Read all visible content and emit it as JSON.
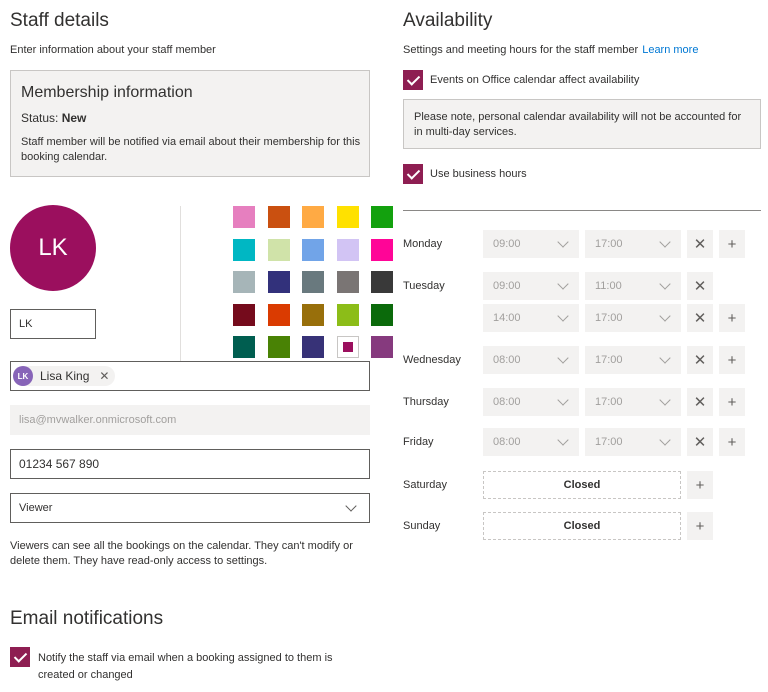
{
  "staff": {
    "title": "Staff details",
    "subtitle": "Enter information about your staff member",
    "membership": {
      "title": "Membership information",
      "status_label": "Status:",
      "status_value": "New",
      "note": "Staff member will be notified via email about their membership for this booking calendar."
    },
    "avatar_initials": "LK",
    "initials_value": "LK",
    "person": {
      "initials": "LK",
      "name": "Lisa King",
      "remove_glyph": "✕"
    },
    "email_value": "lisa@mvwalker.onmicrosoft.com",
    "phone_value": "01234 567 890",
    "role_value": "Viewer",
    "role_description": "Viewers can see all the bookings on the calendar. They can't modify or delete them. They have read-only access to settings.",
    "swatches": [
      "#e67fbf",
      "#ca5010",
      "#ffaa44",
      "#ffe100",
      "#13a10e",
      "#00b7c3",
      "#d0e3a9",
      "#71a4e8",
      "#d2c4f4",
      "#ff0597",
      "#a6b5b8",
      "#32317b",
      "#69797e",
      "#7a7574",
      "#393939",
      "#750b1c",
      "#da3b01",
      "#986f0b",
      "#8cbd18",
      "#0b6a0b",
      "#005e50",
      "#498205",
      "#373277",
      "#9b0f5e",
      "#863a7e"
    ],
    "selected_swatch_index": 23
  },
  "email_notifications": {
    "title": "Email notifications",
    "notify_label": "Notify the staff via email when a booking assigned to them is created or changed",
    "notify_checked": true
  },
  "availability": {
    "title": "Availability",
    "subtitle": "Settings and meeting hours for the staff member",
    "learn_more": "Learn more",
    "events_label": "Events on Office calendar affect availability",
    "events_checked": true,
    "note": "Please note, personal calendar availability will not be accounted for in multi-day services.",
    "business_hours_label": "Use business hours",
    "business_hours_checked": true,
    "days": {
      "monday": {
        "label": "Monday",
        "ranges": [
          [
            "09:00",
            "17:00"
          ]
        ]
      },
      "tuesday": {
        "label": "Tuesday",
        "ranges": [
          [
            "09:00",
            "11:00"
          ],
          [
            "14:00",
            "17:00"
          ]
        ]
      },
      "wednesday": {
        "label": "Wednesday",
        "ranges": [
          [
            "08:00",
            "17:00"
          ]
        ]
      },
      "thursday": {
        "label": "Thursday",
        "ranges": [
          [
            "08:00",
            "17:00"
          ]
        ]
      },
      "friday": {
        "label": "Friday",
        "ranges": [
          [
            "08:00",
            "17:00"
          ]
        ]
      },
      "saturday": {
        "label": "Saturday",
        "closed": "Closed"
      },
      "sunday": {
        "label": "Sunday",
        "closed": "Closed"
      }
    },
    "remove_glyph": "✕",
    "add_glyph": "+"
  },
  "colors": {
    "accent": "#8e1e52",
    "avatar": "#9b0f5e",
    "link": "#0078d4"
  }
}
